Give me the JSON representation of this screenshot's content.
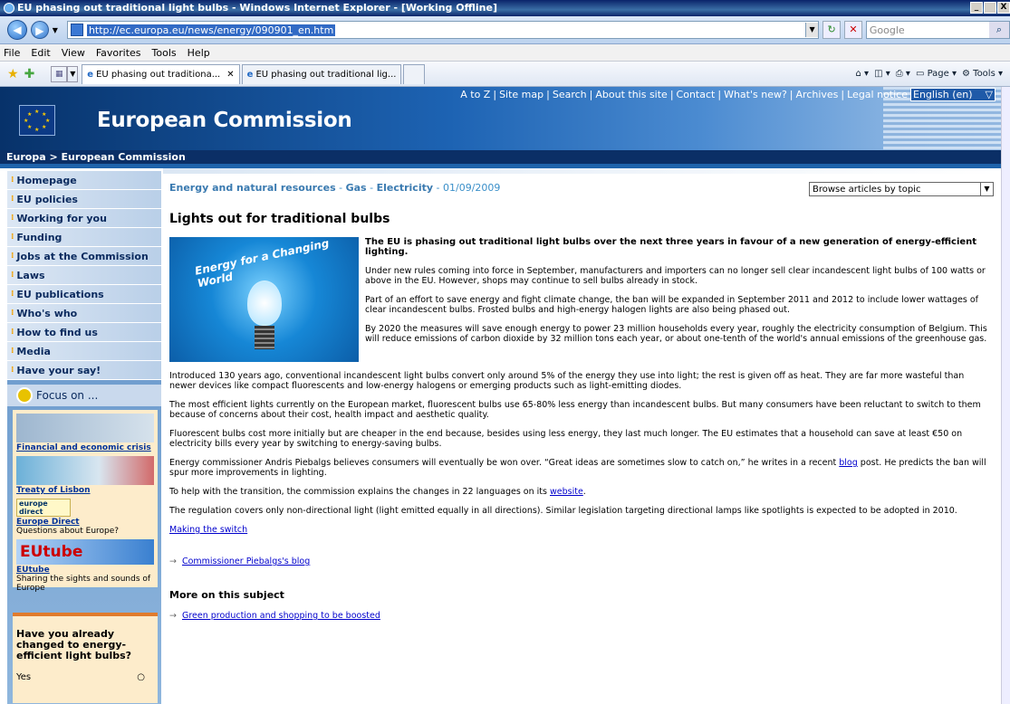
{
  "window": {
    "title": "EU phasing out traditional light bulbs - Windows Internet Explorer - [Working Offline]",
    "controls": [
      "_",
      " ",
      "X"
    ]
  },
  "address": {
    "url": "http://ec.europa.eu/news/energy/090901_en.htm",
    "search_placeholder": "Google"
  },
  "menu": [
    "File",
    "Edit",
    "View",
    "Favorites",
    "Tools",
    "Help"
  ],
  "tabs": [
    {
      "label": "EU phasing out traditiona...",
      "active": true
    },
    {
      "label": "EU phasing out traditional lig...",
      "active": false
    }
  ],
  "command_bar": [
    "Page",
    "Tools"
  ],
  "site": {
    "toplinks": [
      "A to Z",
      "Site map",
      "Search",
      "About this site",
      "Contact",
      "What's new?",
      "Archives",
      "Legal notice"
    ],
    "separator": "|",
    "language": "English (en)",
    "title": "European Commission",
    "breadcrumb": "Europa  >  European Commission"
  },
  "sidebar": {
    "items": [
      "Homepage",
      "EU policies",
      "Working for you",
      "Funding",
      "Jobs at the Commission",
      "Laws",
      "EU publications",
      "Who's who",
      "How to find us",
      "Media",
      "Have your say!"
    ],
    "focus_title": "Focus on ...",
    "focus_items": [
      {
        "link": "Financial and economic crisis",
        "desc": ""
      },
      {
        "link": "Treaty of Lisbon",
        "desc": ""
      },
      {
        "link": "Europe Direct",
        "desc": "Questions about Europe?",
        "logo": "europe direct"
      },
      {
        "link": "EUtube",
        "desc": "Sharing the sights and sounds of Europe",
        "logo": "EUtube"
      }
    ],
    "poll_question": "Have you already changed to energy-efficient light bulbs?",
    "poll_options": [
      "Yes"
    ]
  },
  "article": {
    "meta_links": [
      "Energy and natural resources",
      "Gas",
      "Electricity"
    ],
    "date": "01/09/2009",
    "browse": "Browse articles by topic",
    "title": "Lights out for traditional bulbs",
    "image_text": "Energy for a Changing World",
    "lead_bold": "The EU is phasing out traditional light bulbs over the next three years in favour of a new generation of energy-efficient lighting.",
    "p1": "Under new rules coming into force in September, manufacturers and importers can no longer sell clear incandescent light bulbs of 100 watts or above in the EU. However, shops may continue to sell bulbs already in stock.",
    "p2": "Part of an effort to save energy and fight climate change, the ban will be expanded in September 2011 and 2012 to include lower wattages of clear incandescent bulbs. Frosted bulbs and high-energy halogen lights are also being phased out.",
    "p3": "By 2020 the measures will save enough energy to power 23 million households every year, roughly the electricity consumption of Belgium. This will reduce emissions of carbon dioxide by 32 million tons each year, or about one-tenth of the world's annual emissions of the greenhouse gas.",
    "p4": "Introduced 130 years ago, conventional incandescent light bulbs convert only around 5% of the energy they use into light; the rest is given off as heat. They are far more wasteful than newer devices like compact fluorescents and low-energy halogens or emerging products such as light-emitting diodes.",
    "p5": "The most efficient lights currently on the European market, fluorescent bulbs use 65-80% less energy than incandescent bulbs. But many consumers have been reluctant to switch to them because of concerns about their cost, health impact and aesthetic quality.",
    "p6": "Fluorescent bulbs cost more initially but are cheaper in the end because, besides using less energy, they last much longer. The EU estimates that a household can save at least €50 on electricity bills every year by switching to energy-saving bulbs.",
    "p7a": "Energy commissioner Andris Piebalgs believes consumers will eventually be won over. “Great ideas are sometimes slow to catch on,” he writes in a recent ",
    "p7link": "blog",
    "p7b": " post. He predicts the ban will spur more improvements in lighting.",
    "p8a": "To help with the transition, the commission explains the changes in 22 languages on its ",
    "p8link": "website",
    "p8b": ".",
    "p9": "The regulation covers only non-directional light (light emitted equally in all directions). Similar legislation targeting directional lamps like spotlights is expected to be adopted in 2010.",
    "making_switch": "Making the switch",
    "related": "Commissioner Piebalgs's blog",
    "more_title": "More on this subject",
    "more_link": "Green production and shopping to be boosted"
  }
}
